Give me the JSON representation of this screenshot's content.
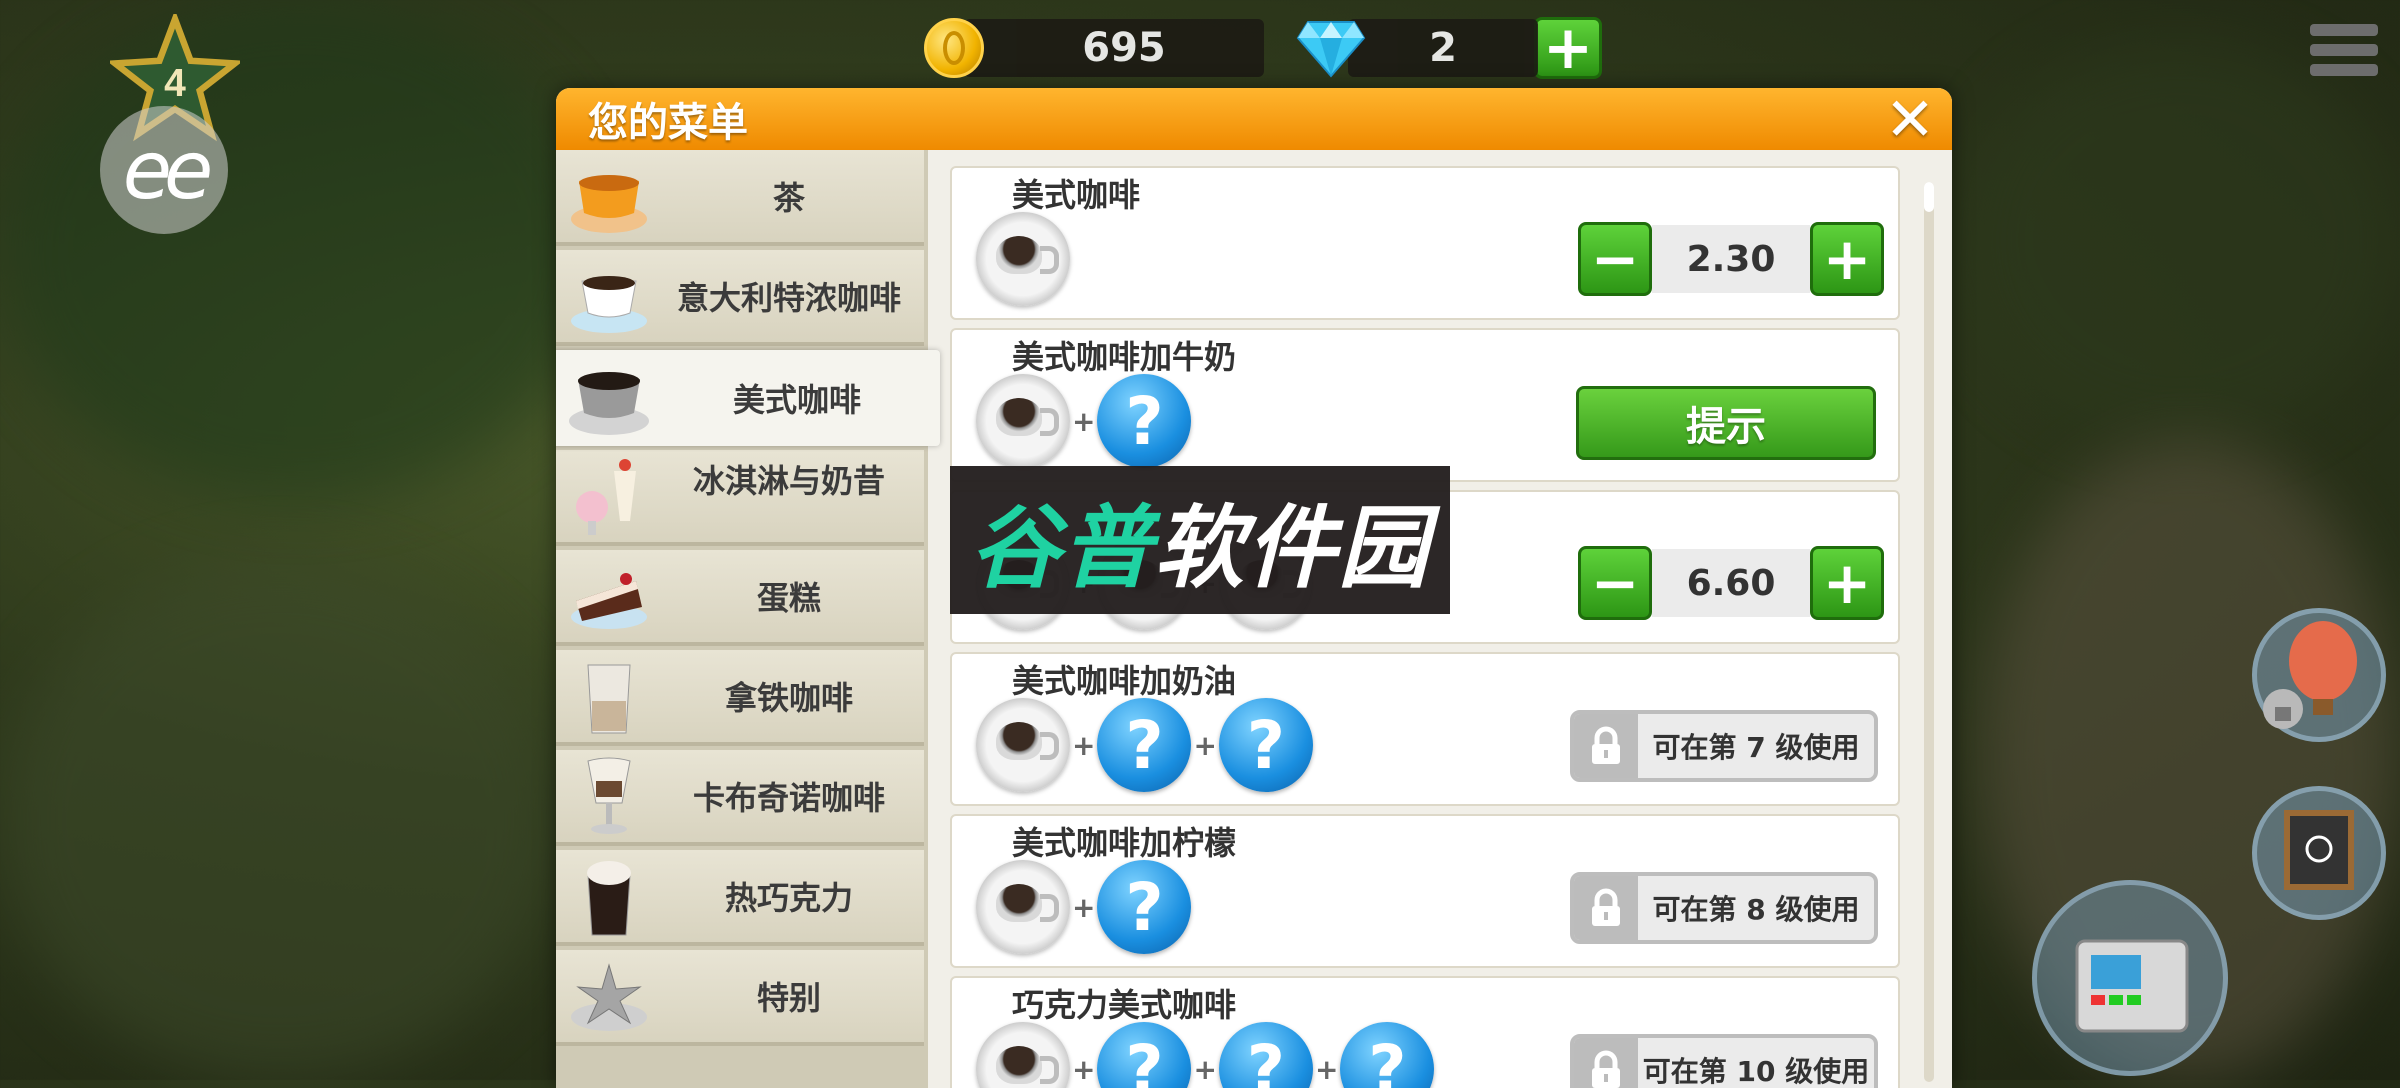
{
  "hud": {
    "level": "4",
    "coins": "695",
    "gems": "2",
    "ee_label": "ee"
  },
  "dialog": {
    "title": "您的菜单",
    "close_label": "✕"
  },
  "categories": [
    {
      "label": "茶",
      "icon": "tea-cup-icon"
    },
    {
      "label": "意大利特浓咖啡",
      "icon": "espresso-cup-icon"
    },
    {
      "label": "美式咖啡",
      "icon": "americano-cup-icon"
    },
    {
      "label": "冰淇淋与奶昔",
      "icon": "ice-cream-icon"
    },
    {
      "label": "蛋糕",
      "icon": "cake-icon"
    },
    {
      "label": "拿铁咖啡",
      "icon": "latte-glass-icon"
    },
    {
      "label": "卡布奇诺咖啡",
      "icon": "cappuccino-glass-icon"
    },
    {
      "label": "热巧克力",
      "icon": "hot-chocolate-icon"
    },
    {
      "label": "特别",
      "icon": "star-anise-icon"
    }
  ],
  "selected_category": "美式咖啡",
  "recipes": [
    {
      "title": "美式咖啡",
      "price": "2.30",
      "unknown_ingredients": 0,
      "state": "price"
    },
    {
      "title": "美式咖啡加牛奶",
      "hint_label": "提示",
      "unknown_ingredients": 1,
      "state": "hint"
    },
    {
      "title": "",
      "price": "6.60",
      "unknown_ingredients": 2,
      "state": "price"
    },
    {
      "title": "美式咖啡加奶油",
      "lock_label": "可在第 7 级使用",
      "unknown_ingredients": 2,
      "state": "locked"
    },
    {
      "title": "美式咖啡加柠檬",
      "lock_label": "可在第 8 级使用",
      "unknown_ingredients": 1,
      "state": "locked"
    },
    {
      "title": "巧克力美式咖啡",
      "lock_label": "可在第 10 级使用",
      "unknown_ingredients": 3,
      "state": "locked"
    }
  ],
  "watermark": {
    "part1": "谷普",
    "part2": "软件园"
  },
  "colors": {
    "header_orange": "#ef8a00",
    "button_green": "#2d9615",
    "question_blue": "#1a8fe0"
  }
}
